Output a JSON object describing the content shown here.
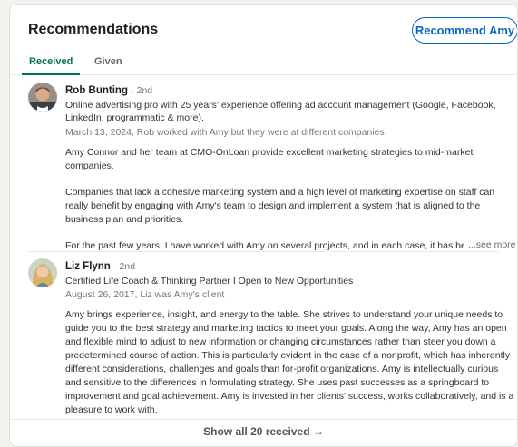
{
  "section": {
    "title": "Recommendations",
    "recommend_button": "Recommend Amy"
  },
  "tabs": [
    {
      "label": "Received"
    },
    {
      "label": "Given"
    }
  ],
  "recommendations": [
    {
      "name": "Rob Bunting",
      "degree": "· 2nd",
      "headline": "Online advertising pro with 25 years' experience offering ad account management (Google, Facebook, LinkedIn, programmatic & more).",
      "meta": "March 13, 2024, Rob worked with Amy but they were at different companies",
      "paragraphs": [
        "Amy Connor and her team at CMO-OnLoan provide excellent marketing strategies to mid-market companies.",
        "Companies that lack a cohesive marketing system and a high level of marketing expertise on staff can really benefit by engaging with Amy's team to design and implement a system that is aligned to the business plan and priorities.",
        "For the past few years, I have worked with Amy on several projects, and in each case, it has beer"
      ],
      "see_more": "...see more"
    },
    {
      "name": "Liz Flynn",
      "degree": "· 2nd",
      "headline": "Certified Life Coach & Thinking Partner I Open to New Opportunities",
      "meta": "August 26, 2017, Liz was Amy's client",
      "paragraphs": [
        "Amy brings experience, insight, and energy to the table. She strives to understand your unique needs to guide you to the best strategy and marketing tactics to meet your goals. Along the way, Amy has an open and flexible mind to adjust to new information or changing circumstances rather than steer you down a predetermined course of action. This is particularly evident in the case of a nonprofit, which has inherently different considerations, challenges and goals than for-profit organizations. Amy is intellectually curious and sensitive to the differences in formulating strategy. She uses past successes as a springboard to improvement and goal achievement. Amy is invested in her clients' success, works collaboratively, and is a pleasure to work with."
      ]
    }
  ],
  "footer": {
    "show_all": "Show all 20 received →"
  },
  "colors": {
    "accent": "#0a66c2",
    "tab_active": "#01754f"
  }
}
